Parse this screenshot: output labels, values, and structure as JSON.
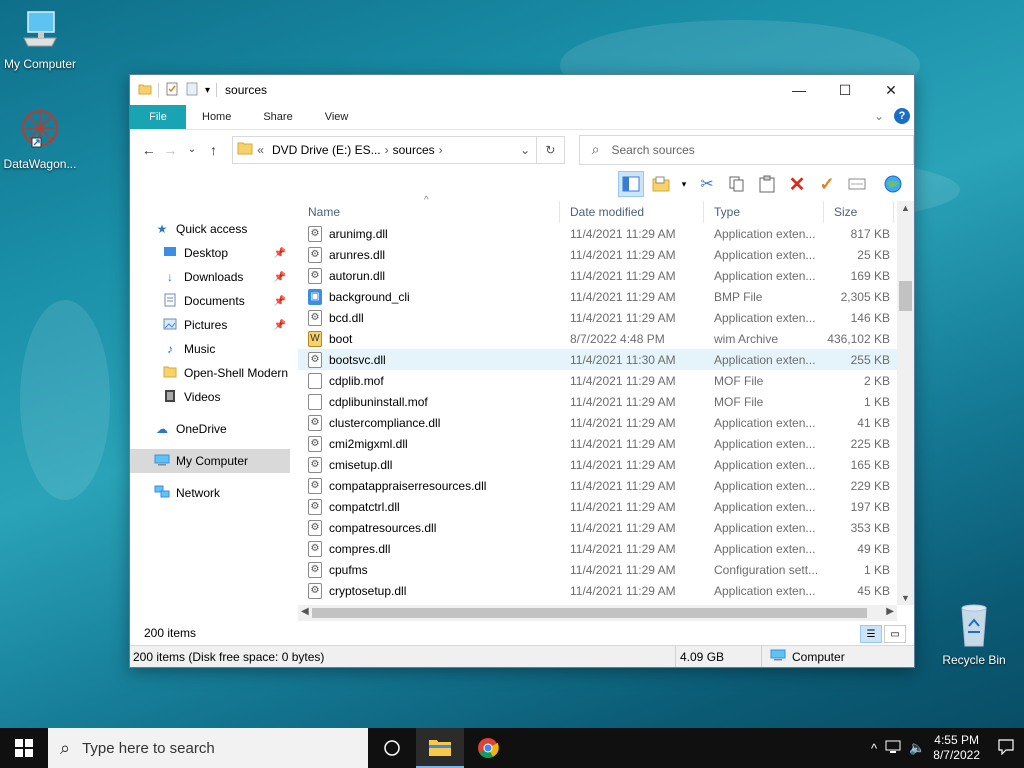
{
  "desktop": {
    "icons": [
      {
        "label": "My Computer",
        "icon": "computer-icon"
      },
      {
        "label": "DataWagon...",
        "icon": "datawagon-icon"
      },
      {
        "label": "Recycle Bin",
        "icon": "recycle-bin-icon"
      }
    ]
  },
  "window": {
    "title": "sources",
    "controls": {
      "minimize": "—",
      "maximize": "☐",
      "close": "✕"
    },
    "ribbon": {
      "tabs": [
        "File",
        "Home",
        "Share",
        "View"
      ],
      "expand": "⌄",
      "help": "?"
    },
    "address": {
      "back": "←",
      "forward": "→",
      "recent": "⌄",
      "up": "↑",
      "overflow": "«",
      "crumbs": [
        "DVD Drive (E:) ES...",
        "sources"
      ],
      "separator": "›",
      "dropdown": "⌄",
      "refresh": "↻"
    },
    "search": {
      "placeholder": "Search sources",
      "icon": "⌕"
    },
    "columns": {
      "name": "Name",
      "date": "Date modified",
      "type": "Type",
      "size": "Size",
      "sort_indicator": "^"
    },
    "nav": {
      "quick_access": "Quick access",
      "items": [
        {
          "label": "Desktop",
          "icon": "desktop-icon",
          "pinned": true
        },
        {
          "label": "Downloads",
          "icon": "downloads-icon",
          "pinned": true
        },
        {
          "label": "Documents",
          "icon": "documents-icon",
          "pinned": true
        },
        {
          "label": "Pictures",
          "icon": "pictures-icon",
          "pinned": true
        },
        {
          "label": "Music",
          "icon": "music-icon",
          "pinned": false
        },
        {
          "label": "Open-Shell Modern",
          "icon": "folder-icon",
          "pinned": false
        },
        {
          "label": "Videos",
          "icon": "videos-icon",
          "pinned": false
        }
      ],
      "pin_glyph": "📌",
      "onedrive": "OneDrive",
      "mycomputer": "My Computer",
      "network": "Network"
    },
    "files": [
      {
        "name": "arunimg.dll",
        "date": "11/4/2021 11:29 AM",
        "type": "Application exten...",
        "size": "817 KB"
      },
      {
        "name": "arunres.dll",
        "date": "11/4/2021 11:29 AM",
        "type": "Application exten...",
        "size": "25 KB"
      },
      {
        "name": "autorun.dll",
        "date": "11/4/2021 11:29 AM",
        "type": "Application exten...",
        "size": "169 KB"
      },
      {
        "name": "background_cli",
        "date": "11/4/2021 11:29 AM",
        "type": "BMP File",
        "size": "2,305 KB"
      },
      {
        "name": "bcd.dll",
        "date": "11/4/2021 11:29 AM",
        "type": "Application exten...",
        "size": "146 KB"
      },
      {
        "name": "boot",
        "date": "8/7/2022 4:48 PM",
        "type": "wim Archive",
        "size": "436,102 KB"
      },
      {
        "name": "bootsvc.dll",
        "date": "11/4/2021 11:30 AM",
        "type": "Application exten...",
        "size": "255 KB"
      },
      {
        "name": "cdplib.mof",
        "date": "11/4/2021 11:29 AM",
        "type": "MOF File",
        "size": "2 KB"
      },
      {
        "name": "cdplibuninstall.mof",
        "date": "11/4/2021 11:29 AM",
        "type": "MOF File",
        "size": "1 KB"
      },
      {
        "name": "clustercompliance.dll",
        "date": "11/4/2021 11:29 AM",
        "type": "Application exten...",
        "size": "41 KB"
      },
      {
        "name": "cmi2migxml.dll",
        "date": "11/4/2021 11:29 AM",
        "type": "Application exten...",
        "size": "225 KB"
      },
      {
        "name": "cmisetup.dll",
        "date": "11/4/2021 11:29 AM",
        "type": "Application exten...",
        "size": "165 KB"
      },
      {
        "name": "compatappraiserresources.dll",
        "date": "11/4/2021 11:29 AM",
        "type": "Application exten...",
        "size": "229 KB"
      },
      {
        "name": "compatctrl.dll",
        "date": "11/4/2021 11:29 AM",
        "type": "Application exten...",
        "size": "197 KB"
      },
      {
        "name": "compatresources.dll",
        "date": "11/4/2021 11:29 AM",
        "type": "Application exten...",
        "size": "353 KB"
      },
      {
        "name": "compres.dll",
        "date": "11/4/2021 11:29 AM",
        "type": "Application exten...",
        "size": "49 KB"
      },
      {
        "name": "cpufms",
        "date": "11/4/2021 11:29 AM",
        "type": "Configuration sett...",
        "size": "1 KB"
      },
      {
        "name": "cryptosetup.dll",
        "date": "11/4/2021 11:29 AM",
        "type": "Application exten...",
        "size": "45 KB"
      }
    ],
    "status": {
      "item_count": "200 items",
      "details": "200 items (Disk free space: 0 bytes)",
      "size": "4.09 GB",
      "location": "Computer"
    }
  },
  "taskbar": {
    "search_placeholder": "Type here to search",
    "time": "4:55 PM",
    "date": "8/7/2022",
    "tray_chevron": "^"
  },
  "colors": {
    "file_tab": "#19a3b3",
    "selection": "#d9d9d9",
    "hover_row": "#e5f3fb",
    "taskbar": "#101010"
  }
}
